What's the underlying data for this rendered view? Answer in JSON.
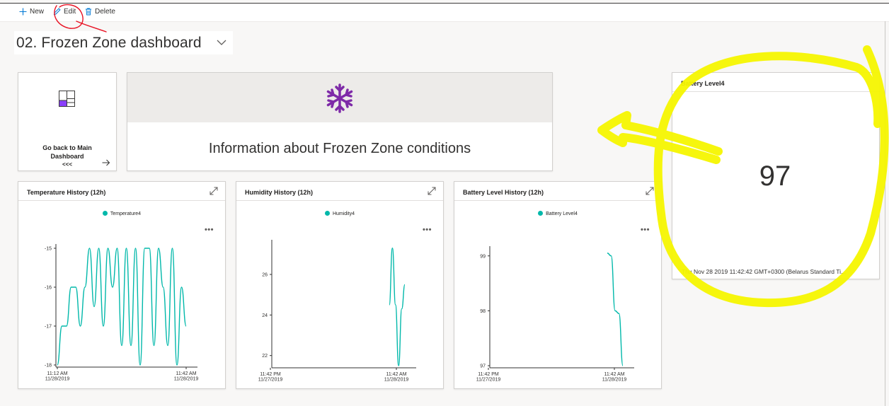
{
  "toolbar": {
    "new_label": "New",
    "edit_label": "Edit",
    "delete_label": "Delete"
  },
  "dashboard": {
    "title": "02. Frozen Zone dashboard"
  },
  "nav_tile": {
    "label_line1": "Go back to Main",
    "label_line2": "Dashboard",
    "label_line3": "<<<"
  },
  "info_tile": {
    "text": "Information about Frozen Zone conditions",
    "icon": "snowflake-icon"
  },
  "battery_tile": {
    "title": "Battery Level4",
    "value": "97",
    "timestamp": "Thu Nov 28 2019 11:42:42 GMT+0300 (Belarus Standard Ti..."
  },
  "colors": {
    "series": "#01b8aa",
    "accent": "#8a2be2",
    "highlight": "#f5f500",
    "annotation": "#e81123"
  },
  "chart_data": [
    {
      "type": "line",
      "title": "Temperature History (12h)",
      "series": [
        {
          "name": "Temperature4",
          "values": [
            -18,
            -17,
            -17,
            -16,
            -16,
            -17,
            -16,
            -15,
            -16.5,
            -15,
            -17,
            -15,
            -16,
            -15,
            -17.5,
            -15,
            -17.5,
            -15,
            -18,
            -15,
            -15,
            -17.5,
            -15,
            -16,
            -17.5,
            -15,
            -18,
            -16,
            -17
          ]
        }
      ],
      "ylim": [
        -18,
        -15
      ],
      "yticks": [
        "-15",
        "-16",
        "-17",
        "-18"
      ],
      "xticks": [
        [
          "11:12 AM",
          "11/28/2019"
        ],
        [
          "11:42 AM",
          "11/28/2019"
        ]
      ]
    },
    {
      "type": "line",
      "title": "Humidity History (12h)",
      "series": [
        {
          "name": "Humidity4",
          "values": [
            24.5,
            27.3,
            24.5,
            21.5,
            24.3,
            25.5
          ]
        }
      ],
      "ylim": [
        21.5,
        27.5
      ],
      "yticks": [
        "26",
        "24",
        "22"
      ],
      "xticks": [
        [
          "11:42 PM",
          "11/27/2019"
        ],
        [
          "11:42 AM",
          "11/28/2019"
        ]
      ]
    },
    {
      "type": "line",
      "title": "Battery Level History (12h)",
      "series": [
        {
          "name": "Battery Level4",
          "values": [
            99.05,
            99,
            98,
            97.95,
            97
          ]
        }
      ],
      "ylim": [
        97,
        99.1
      ],
      "yticks": [
        "99",
        "98",
        "97"
      ],
      "xticks": [
        [
          "11:42 PM",
          "11/27/2019"
        ],
        [
          "11:42 AM",
          "11/28/2019"
        ]
      ]
    }
  ]
}
